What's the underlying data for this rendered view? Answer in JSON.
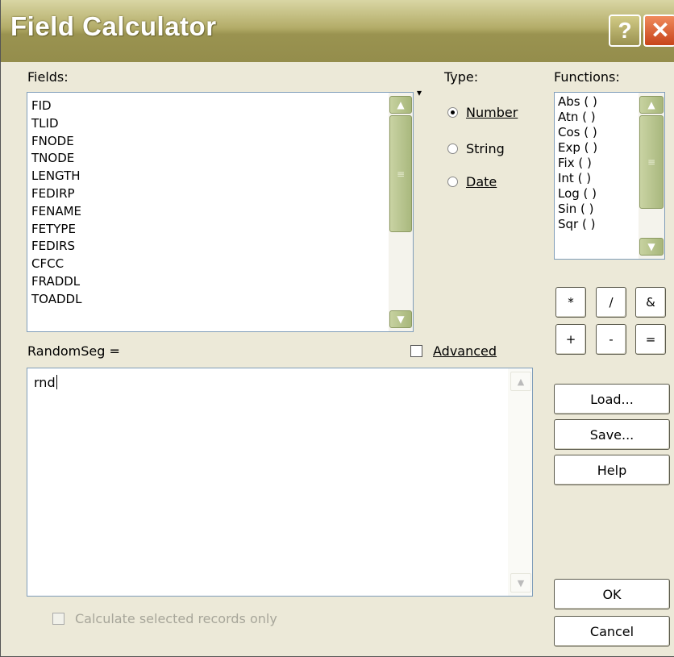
{
  "window": {
    "title": "Field Calculator"
  },
  "titlebar": {
    "help_glyph": "?",
    "close_glyph": "✕"
  },
  "fields": {
    "label": "Fields:",
    "items": [
      "FID",
      "TLID",
      "FNODE",
      "TNODE",
      "LENGTH",
      "FEDIRP",
      "FENAME",
      "FETYPE",
      "FEDIRS",
      "CFCC",
      "FRADDL",
      "TOADDL"
    ]
  },
  "type": {
    "label": "Type:",
    "options": [
      {
        "label": "Number",
        "selected": true
      },
      {
        "label": "String",
        "selected": false
      },
      {
        "label": "Date",
        "selected": false
      }
    ]
  },
  "functions": {
    "label": "Functions:",
    "items": [
      "Abs ( )",
      "Atn ( )",
      "Cos ( )",
      "Exp ( )",
      "Fix ( )",
      "Int ( )",
      "Log ( )",
      "Sin ( )",
      "Sqr ( )"
    ]
  },
  "operators": [
    "*",
    "/",
    "&",
    "+",
    "-",
    "="
  ],
  "expression": {
    "label": "RandomSeg =",
    "value": "rnd"
  },
  "advanced": {
    "label": "Advanced",
    "checked": false
  },
  "calc_selected": {
    "label": "Calculate selected records only",
    "checked": false,
    "enabled": false
  },
  "buttons": {
    "load": "Load...",
    "save": "Save...",
    "help": "Help",
    "ok": "OK",
    "cancel": "Cancel"
  },
  "icons": {
    "scroll_up": "▲",
    "scroll_down": "▼",
    "grip": "≡",
    "small_dropdown": "▾"
  },
  "colors": {
    "titlebar": "#a9a25e",
    "dialog_bg": "#ece9d8",
    "close": "#d85a2a"
  }
}
